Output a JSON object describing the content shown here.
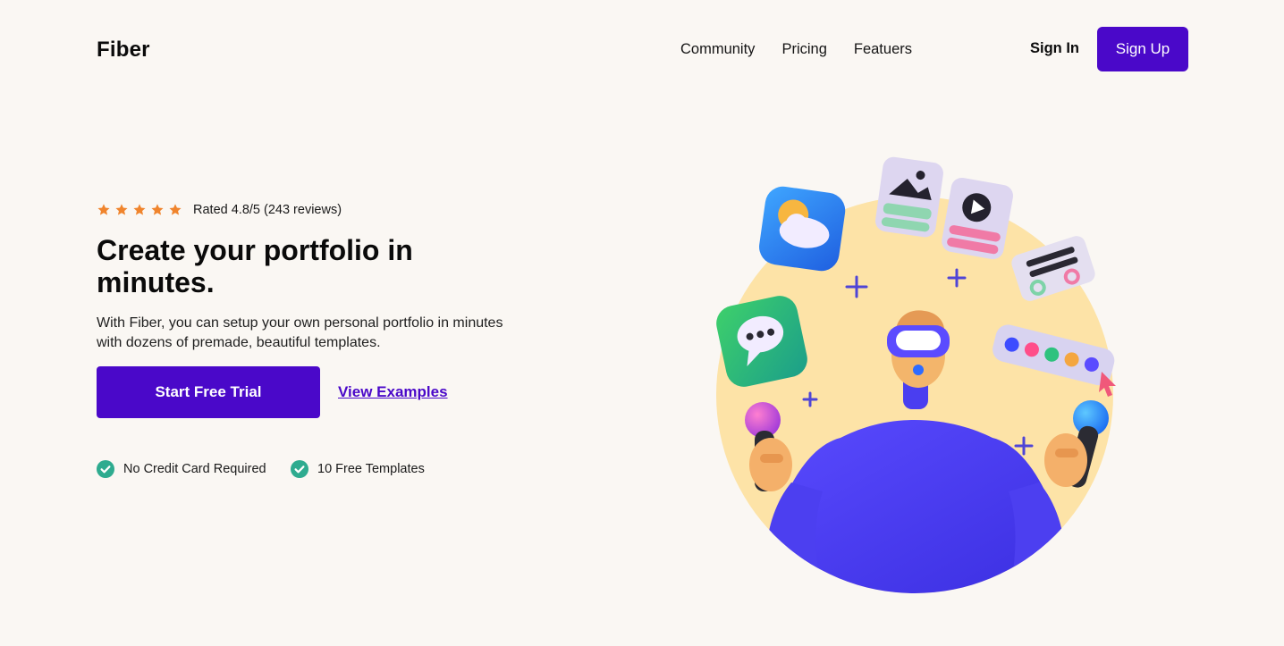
{
  "header": {
    "logo": "Fiber",
    "nav": [
      {
        "label": "Community"
      },
      {
        "label": "Pricing"
      },
      {
        "label": "Featuers"
      }
    ],
    "sign_in_label": "Sign In",
    "sign_up_label": "Sign Up"
  },
  "hero": {
    "rating": {
      "stars": 5,
      "text": "Rated 4.8/5 (243 reviews)"
    },
    "headline": "Create your portfolio in minutes.",
    "subtext": "With Fiber, you can setup your own personal portfolio in minutes with dozens of premade, beautiful templates.",
    "primary_button": "Start Free Trial",
    "secondary_link": "View Examples",
    "features": [
      {
        "label": "No Credit Card Required"
      },
      {
        "label": "10 Free Templates"
      }
    ]
  },
  "colors": {
    "brand": "#4a08c9",
    "star": "#f0842c",
    "check": "#2eab8f",
    "background": "#faf7f3",
    "illustration_circle": "#fde3a7"
  },
  "icons": {
    "star": "star-icon",
    "check": "check-circle-icon"
  }
}
